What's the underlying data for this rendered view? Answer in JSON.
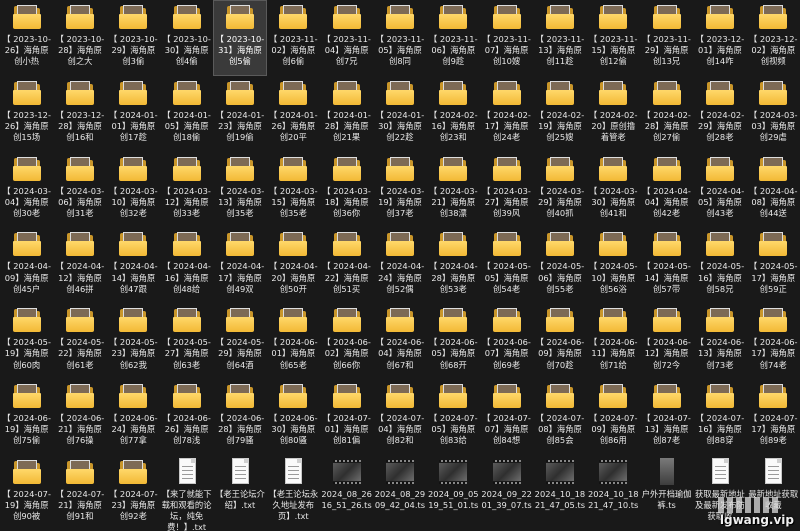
{
  "items": [
    {
      "type": "folder",
      "label": "【 2023-10-26】海角原创小热"
    },
    {
      "type": "folder",
      "label": "【 2023-10-28】海角原创之大"
    },
    {
      "type": "folder",
      "label": "【 2023-10-29】海角原创3偷"
    },
    {
      "type": "folder",
      "label": "【 2023-10-30】海角原创4偷"
    },
    {
      "type": "folder",
      "label": "【 2023-10-31】海角原创5偷",
      "selected": true
    },
    {
      "type": "folder",
      "label": "【 2023-11-02】海角原创6偷"
    },
    {
      "type": "folder",
      "label": "【 2023-11-04】海角原创7兄"
    },
    {
      "type": "folder",
      "label": "【 2023-11-05】海角原创8同"
    },
    {
      "type": "folder",
      "label": "【 2023-11-06】海角原创9趁"
    },
    {
      "type": "folder",
      "label": "【 2023-11-07】海角原创10嫂"
    },
    {
      "type": "folder",
      "label": "【 2023-11-13】海角原创11趁"
    },
    {
      "type": "folder",
      "label": "【 2023-11-15】海角原创12偷"
    },
    {
      "type": "folder",
      "label": "【 2023-11-29】海角原创13兄"
    },
    {
      "type": "folder",
      "label": "【 2023-12-01】海角原创14咋"
    },
    {
      "type": "folder",
      "label": "【 2023-12-02】海角原创视频"
    },
    {
      "type": "folder",
      "label": "【 2023-12-26】海角原创15场"
    },
    {
      "type": "folder",
      "label": "【 2023-12-28】海角原创16和"
    },
    {
      "type": "folder",
      "label": "【 2024-01-01】海角原创17趁"
    },
    {
      "type": "folder",
      "label": "【 2024-01-05】海角原创18偷"
    },
    {
      "type": "folder",
      "label": "【 2024-01-23】海角原创19偷"
    },
    {
      "type": "folder",
      "label": "【 2024-01-26】海角原创20平"
    },
    {
      "type": "folder",
      "label": "【 2024-01-28】海角原创21果"
    },
    {
      "type": "folder",
      "label": "【 2024-01-30】海角原创22趁"
    },
    {
      "type": "folder",
      "label": "【 2024-02-16】海角原创23和"
    },
    {
      "type": "folder",
      "label": "【 2024-02-17】海角原创24老"
    },
    {
      "type": "folder",
      "label": "【 2024-02-19】海角原创25嫂"
    },
    {
      "type": "folder",
      "label": "【 2024-02-20】原创撸着管老"
    },
    {
      "type": "folder",
      "label": "【 2024-02-28】海角原创27偷"
    },
    {
      "type": "folder",
      "label": "【 2024-02-29】海角原创28老"
    },
    {
      "type": "folder",
      "label": "【 2024-03-03】海角原创29虐"
    },
    {
      "type": "folder",
      "label": "【 2024-03-04】海角原创30老"
    },
    {
      "type": "folder",
      "label": "【 2024-03-06】海角原创31老"
    },
    {
      "type": "folder",
      "label": "【 2024-03-10】海角原创32老"
    },
    {
      "type": "folder",
      "label": "【 2024-03-12】海角原创33老"
    },
    {
      "type": "folder",
      "label": "【 2024-03-13】海角原创35老"
    },
    {
      "type": "folder",
      "label": "【 2024-03-15】海角原创35老"
    },
    {
      "type": "folder",
      "label": "【 2024-03-18】海角原创36你"
    },
    {
      "type": "folder",
      "label": "【 2024-03-19】海角原创37老"
    },
    {
      "type": "folder",
      "label": "【 2024-03-21】海角原创38漂"
    },
    {
      "type": "folder",
      "label": "【 2024-03-27】海角原创39风"
    },
    {
      "type": "folder",
      "label": "【 2024-03-29】海角原创40抓"
    },
    {
      "type": "folder",
      "label": "【 2024-03-30】海角原创41和"
    },
    {
      "type": "folder",
      "label": "【 2024-04-04】海角原创42老"
    },
    {
      "type": "folder",
      "label": "【 2024-04-05】海角原创43老"
    },
    {
      "type": "folder",
      "label": "【 2024-04-08】海角原创44送"
    },
    {
      "type": "folder",
      "label": "【 2024-04-09】海角原创45户"
    },
    {
      "type": "folder",
      "label": "【 2024-04-12】海角原创46拼"
    },
    {
      "type": "folder",
      "label": "【 2024-04-14】海角原创47跟"
    },
    {
      "type": "folder",
      "label": "【 2024-04-16】海角原创48给"
    },
    {
      "type": "folder",
      "label": "【 2024-04-17】海角原创49双"
    },
    {
      "type": "folder",
      "label": "【 2024-04-20】海角原创50开"
    },
    {
      "type": "folder",
      "label": "【 2024-04-22】海角原创51买"
    },
    {
      "type": "folder",
      "label": "【 2024-04-24】海角原创52偶"
    },
    {
      "type": "folder",
      "label": "【 2024-04-28】海角原创53老"
    },
    {
      "type": "folder",
      "label": "【 2024-05-05】海角原创54老"
    },
    {
      "type": "folder",
      "label": "【 2024-05-06】海角原创55老"
    },
    {
      "type": "folder",
      "label": "【 2024-05-10】海角原创56浴"
    },
    {
      "type": "folder",
      "label": "【 2024-05-14】海角原创57带"
    },
    {
      "type": "folder",
      "label": "【 2024-05-16】海角原创58兄"
    },
    {
      "type": "folder",
      "label": "【 2024-05-17】海角原创59正"
    },
    {
      "type": "folder",
      "label": "【 2024-05-19】海角原创60肉"
    },
    {
      "type": "folder",
      "label": "【 2024-05-22】海角原创61老"
    },
    {
      "type": "folder",
      "label": "【 2024-05-23】海角原创62我"
    },
    {
      "type": "folder",
      "label": "【 2024-05-27】海角原创63老"
    },
    {
      "type": "folder",
      "label": "【 2024-05-29】海角原创64酒"
    },
    {
      "type": "folder",
      "label": "【 2024-06-01】海角原创65老"
    },
    {
      "type": "folder",
      "label": "【 2024-06-02】海角原创66你"
    },
    {
      "type": "folder",
      "label": "【 2024-06-04】海角原创67和"
    },
    {
      "type": "folder",
      "label": "【 2024-06-05】海角原创68开"
    },
    {
      "type": "folder",
      "label": "【 2024-06-07】海角原创69老"
    },
    {
      "type": "folder",
      "label": "【 2024-06-09】海角原创70趁"
    },
    {
      "type": "folder",
      "label": "【 2024-06-11】海角原创71给"
    },
    {
      "type": "folder",
      "label": "【 2024-06-12】海角原创72今"
    },
    {
      "type": "folder",
      "label": "【 2024-06-13】海角原创73老"
    },
    {
      "type": "folder",
      "label": "【 2024-06-17】海角原创74老"
    },
    {
      "type": "folder",
      "label": "【 2024-06-19】海角原创75偷"
    },
    {
      "type": "folder",
      "label": "【 2024-06-21】海角原创76操"
    },
    {
      "type": "folder",
      "label": "【 2024-06-24】海角原创77拿"
    },
    {
      "type": "folder",
      "label": "【 2024-06-26】海角原创78浅"
    },
    {
      "type": "folder",
      "label": "【 2024-06-28】海角原创79骚"
    },
    {
      "type": "folder",
      "label": "【 2024-06-30】海角原创80骚"
    },
    {
      "type": "folder",
      "label": "【 2024-07-01】海角原创81偏"
    },
    {
      "type": "folder",
      "label": "【 2024-07-04】海角原创82和"
    },
    {
      "type": "folder",
      "label": "【 2024-07-05】海角原创83给"
    },
    {
      "type": "folder",
      "label": "【 2024-07-07】海角原创84想"
    },
    {
      "type": "folder",
      "label": "【 2024-07-08】海角原创85会"
    },
    {
      "type": "folder",
      "label": "【 2024-07-09】海角原创86用"
    },
    {
      "type": "folder",
      "label": "【 2024-07-13】海角原创87老"
    },
    {
      "type": "folder",
      "label": "【 2024-07-16】海角原创88穿"
    },
    {
      "type": "folder",
      "label": "【 2024-07-17】海角原创89老"
    },
    {
      "type": "folder",
      "label": "【 2024-07-19】海角原创90被"
    },
    {
      "type": "folder",
      "label": "【 2024-07-21】海角原创91和"
    },
    {
      "type": "folder",
      "label": "【 2024-07-23】海角原创92老"
    },
    {
      "type": "txt",
      "label": "【来了就能下载和观看的论坛，纯免费！】.txt"
    },
    {
      "type": "txt",
      "label": "【老王论坛介绍】.txt"
    },
    {
      "type": "txt",
      "label": "【老王论坛永久地址发布页】.txt"
    },
    {
      "type": "video",
      "label": "2024_08_26 16_51_26.ts"
    },
    {
      "type": "video",
      "label": "2024_08_29 09_42_04.ts"
    },
    {
      "type": "video",
      "label": "2024_09_05 19_51_01.ts"
    },
    {
      "type": "video",
      "label": "2024_09_22 01_39_07.ts"
    },
    {
      "type": "video",
      "label": "2024_10_18 21_47_05.ts"
    },
    {
      "type": "video",
      "label": "2024_10_18 21_47_10.ts"
    },
    {
      "type": "portrait",
      "label": "户外开档瑜伽裤.ts"
    },
    {
      "type": "txt",
      "label": "获取最新地址及最新发布防 获取收"
    },
    {
      "type": "txt",
      "label": "最新地址获取收藏"
    }
  ],
  "watermark": {
    "text": "lgwang.vip"
  }
}
